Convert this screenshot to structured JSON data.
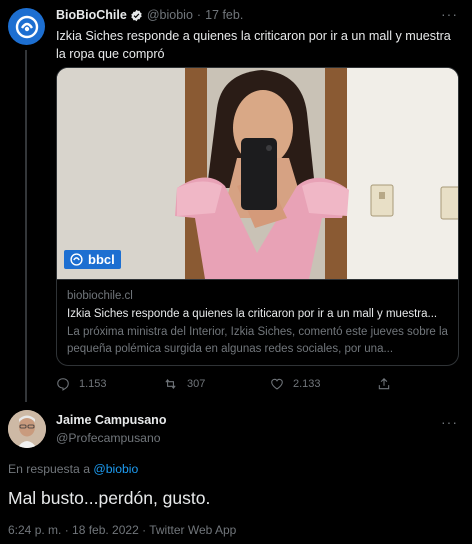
{
  "parent_tweet": {
    "author_name": "BioBioChile",
    "handle": "@biobio",
    "date": "17 feb.",
    "separator": "·",
    "text": "Izkia Siches responde a quienes la criticaron por ir a un mall y muestra la ropa que compró",
    "card": {
      "badge_label": "bbcl",
      "domain": "biobiochile.cl",
      "title": "Izkia Siches responde a quienes la criticaron por ir a un mall y muestra...",
      "description": "La próxima ministra del Interior, Izkia Siches, comentó este jueves sobre la pequeña polémica surgida en algunas redes sociales, por una..."
    },
    "actions": {
      "replies": "1.153",
      "retweets": "307",
      "likes": "2.133"
    }
  },
  "reply_tweet": {
    "author_name": "Jaime Campusano",
    "handle": "@Profecampusano",
    "reply_prefix": "En respuesta a",
    "reply_target": "@biobio",
    "text": "Mal busto...perdón, gusto.",
    "meta": "6:24 p. m. · 18 feb. 2022 · Twitter Web App"
  },
  "colors": {
    "background": "#000000",
    "primary_text": "#e7e9ea",
    "secondary_text": "#71767b",
    "link": "#1d9bf0",
    "brand_blue": "#1d6fd1"
  },
  "icons": {
    "verified": "verified-badge-icon",
    "reply": "reply-icon",
    "retweet": "retweet-icon",
    "like": "heart-icon",
    "share": "share-icon",
    "more": "more-options-icon"
  }
}
